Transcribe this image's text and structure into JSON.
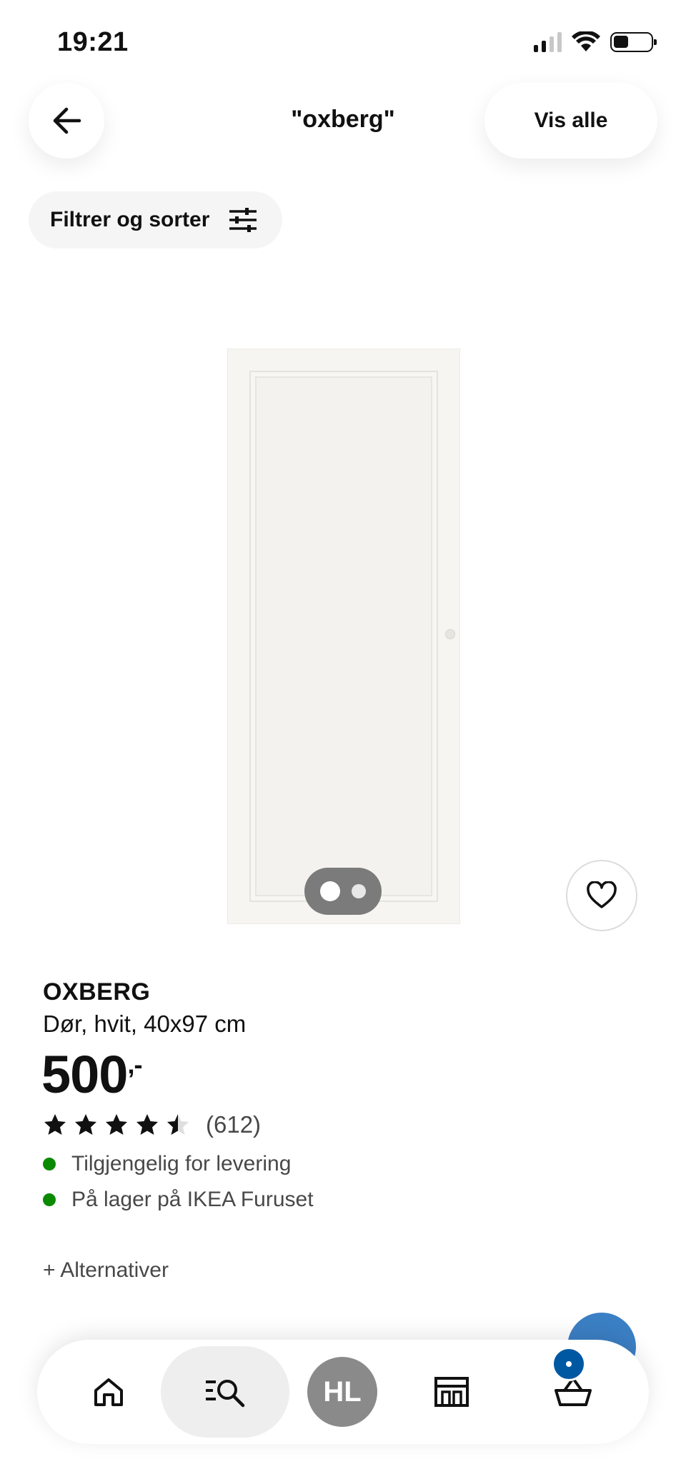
{
  "status_bar": {
    "time": "19:21",
    "icons": [
      "cellular-signal-icon",
      "wifi-icon",
      "battery-icon"
    ]
  },
  "header": {
    "back_icon": "arrow-left-icon",
    "title": "\"oxberg\"",
    "show_all_label": "Vis alle"
  },
  "filter": {
    "label": "Filtrer og sorter",
    "icon": "sliders-icon"
  },
  "product": {
    "name": "OXBERG",
    "description": "Dør, hvit, 40x97 cm",
    "price": "500",
    "price_suffix": ",-",
    "rating": 4.5,
    "rating_max": 5,
    "review_count": "(612)",
    "availability": [
      {
        "text": "Tilgjengelig for levering",
        "status_color": "#0a8a00"
      },
      {
        "text": "På lager på IKEA Furuset",
        "status_color": "#0a8a00"
      }
    ],
    "alternatives_label": "+ Alternativer",
    "image_pages": 2,
    "image_current_page": 1
  },
  "bottom_nav": {
    "items": [
      {
        "icon": "home-icon"
      },
      {
        "icon": "search-list-icon",
        "active": true
      },
      {
        "avatar_initials": "HL"
      },
      {
        "icon": "store-icon"
      },
      {
        "icon": "basket-icon"
      }
    ]
  },
  "colors": {
    "accent_blue": "#0058a3",
    "available_green": "#0a8a00",
    "chip_gray": "#f5f5f5"
  }
}
